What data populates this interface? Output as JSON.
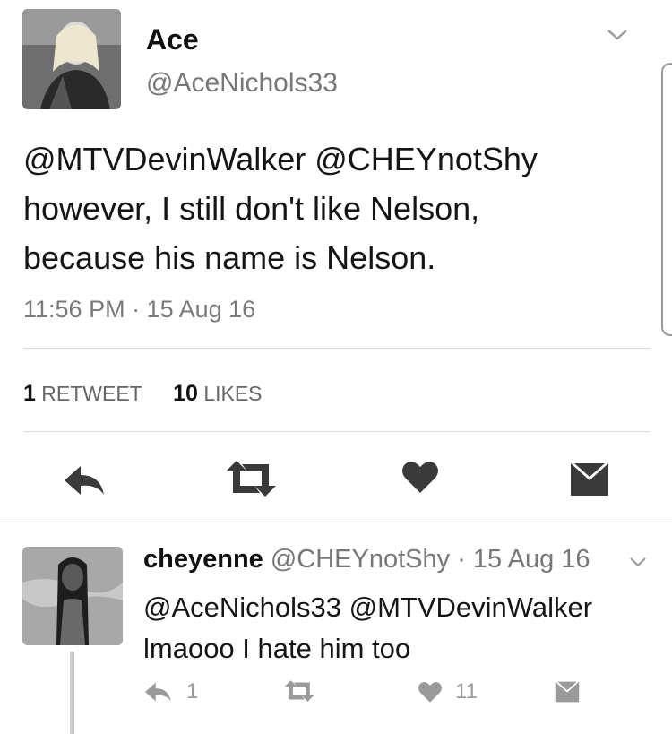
{
  "main_tweet": {
    "display_name": "Ace",
    "handle": "@AceNichols33",
    "text_line1": "@MTVDevinWalker @CHEYnotShy",
    "text_line2": "however, I still don't like Nelson,",
    "text_line3": "because his name is Nelson.",
    "timestamp": "11:56 PM · 15 Aug 16",
    "retweet_count": "1",
    "retweet_label": "RETWEET",
    "like_count": "10",
    "like_label": "LIKES"
  },
  "reply_tweet": {
    "display_name": "cheyenne",
    "handle_and_date": "@CHEYnotShy · 15 Aug 16",
    "text_line1": "@AceNichols33 @MTVDevinWalker",
    "text_line2": "lmaooo I hate him too",
    "reply_count": "1",
    "like_count": "11"
  },
  "icons": {
    "reply": "reply-icon",
    "retweet": "retweet-icon",
    "like": "heart-icon",
    "dm": "envelope-icon",
    "menu": "chevron-down-icon"
  },
  "colors": {
    "text": "#111111",
    "secondary": "#777777",
    "icon": "#3a3a3a",
    "divider": "#d9d9d9"
  }
}
